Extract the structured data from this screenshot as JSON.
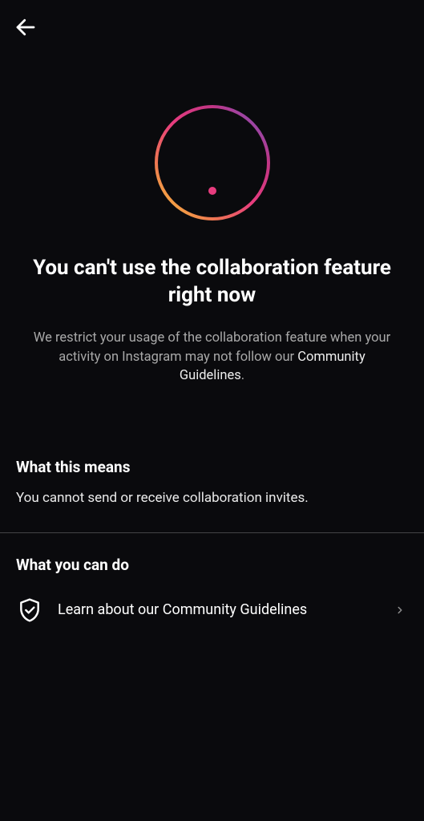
{
  "header": {
    "back_label": "Back"
  },
  "hero": {
    "title": "You can't use the collaboration feature right now",
    "subtitle_prefix": "We restrict your usage of the collaboration feature when your activity on Instagram may not follow our ",
    "subtitle_link": "Community Guidelines",
    "subtitle_suffix": "."
  },
  "section_means": {
    "heading": "What this means",
    "body": "You cannot send or receive collaboration invites."
  },
  "section_do": {
    "heading": "What you can do",
    "action_label": "Learn about our Community Guidelines"
  }
}
